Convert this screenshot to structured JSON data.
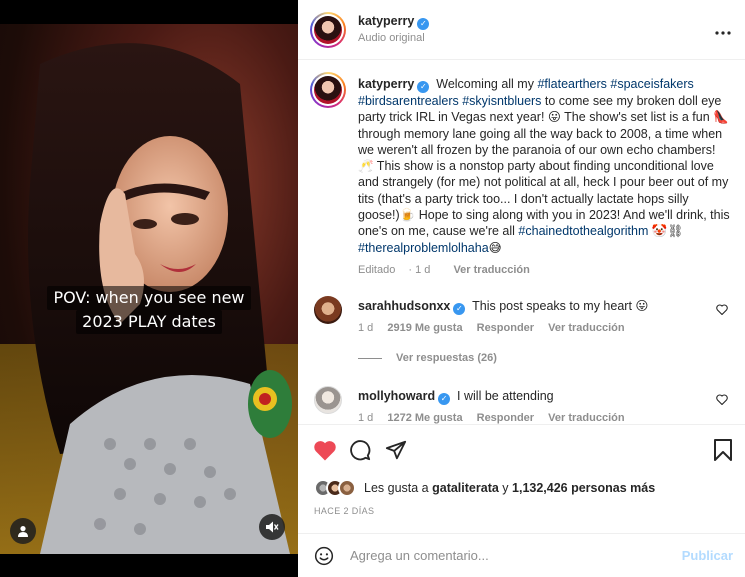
{
  "post": {
    "author": "katyperry",
    "audio_label": "Audio original"
  },
  "media": {
    "caption_line1": "POV: when you see new",
    "caption_line2": "2023 PLAY dates"
  },
  "caption": {
    "author": "katyperry",
    "segments": [
      {
        "t": "Welcoming all my ",
        "tag": false
      },
      {
        "t": "#flatearthers",
        "tag": true
      },
      {
        "t": " ",
        "tag": false
      },
      {
        "t": "#spaceisfakers",
        "tag": true
      },
      {
        "t": " ",
        "tag": false
      },
      {
        "t": "#birdsarentrealers",
        "tag": true
      },
      {
        "t": " ",
        "tag": false
      },
      {
        "t": "#skyisntbluers",
        "tag": true
      },
      {
        "t": " to come see my broken doll eye party trick IRL in Vegas next year! 😛 The show's set list is a fun 👠 through memory lane going all the way back to 2008, a time when we weren't all frozen by the paranoia of our own echo chambers! 🥂 This show is a nonstop party about finding unconditional love and strangely (for me) not political at all, heck I pour beer out of my tits (that's a party trick too... I don't actually lactate hops silly goose!)🍺 Hope to sing along with you in 2023! And we'll drink, this one's on me, cause we're all ",
        "tag": false
      },
      {
        "t": "#chainedtothealgorithm",
        "tag": true
      },
      {
        "t": " 🤡⛓ ",
        "tag": false
      },
      {
        "t": "#therealproblemlolhaha",
        "tag": true
      },
      {
        "t": "😅",
        "tag": false
      }
    ],
    "edited": "Editado",
    "edited_time": "1 d",
    "see_translation": "Ver traducción"
  },
  "comments": [
    {
      "user": "sarahhudsonxx",
      "text": "This post speaks to my heart 😛",
      "time": "1 d",
      "likes": "2919 Me gusta",
      "reply": "Responder",
      "translate": "Ver traducción"
    },
    {
      "user": "mollyhoward",
      "text": "I will be attending",
      "time": "1 d",
      "likes": "1272 Me gusta",
      "reply": "Responder",
      "translate": "Ver traducción"
    }
  ],
  "replies_label": "Ver respuestas (26)",
  "likes": {
    "prefix": "Les gusta a ",
    "user": "gataliterata",
    "middle": " y ",
    "count": "1,132,426 personas más"
  },
  "timestamp": "HACE 2 DÍAS",
  "add_comment": {
    "placeholder": "Agrega un comentario...",
    "publish": "Publicar"
  },
  "colors": {
    "like_red": "#ed4956",
    "hashtag": "#00376b",
    "verified": "#3897f0",
    "publish_disabled": "#b3dbff"
  }
}
